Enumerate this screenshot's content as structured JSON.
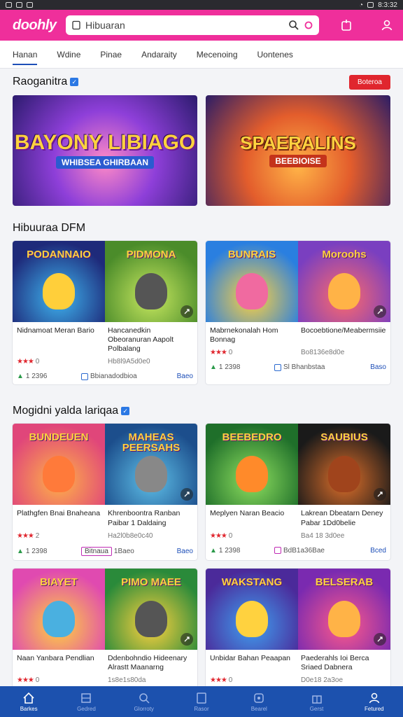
{
  "status_bar": {
    "time": "8:3:32"
  },
  "app_bar": {
    "logo": "doohly",
    "search_value": "Hibuaran"
  },
  "tabs": [
    "Hanan",
    "Wdine",
    "Pinae",
    "Andaraity",
    "Mecenoing",
    "Uontenes"
  ],
  "section1": {
    "title": "Raoganitra",
    "badge_label": "Boteroa"
  },
  "banners": [
    {
      "title": "BAYONY LIBIAGO",
      "subtitle": "WHIBSEA GHIRBAAN"
    },
    {
      "title": "SPAERALINS",
      "subtitle": "BEEBIOISE"
    }
  ],
  "section2": {
    "title": "Hibuuraa DFM"
  },
  "section3": {
    "title": "Mogidni yalda lariqaa"
  },
  "cards": [
    {
      "arts": [
        "PODANNAIO",
        "PIDMONA"
      ],
      "names": [
        "Nidnamoat Meran Bario",
        "Hancanedkin Obeoranuran Aapolt Polbalang"
      ],
      "rating": "0",
      "stars": "★★★",
      "meta": "Hb8l9A5d0e0",
      "count": "1 2396",
      "tag": "Bbianadodbioa",
      "mid_icon": "chk",
      "link": "Baeo"
    },
    {
      "arts": [
        "BUNRAIS",
        "Moroohs"
      ],
      "names": [
        "Mabrnekonalah Hom Bonnag",
        "Bocoebtione/Meabermsiie"
      ],
      "rating": "0",
      "stars": "★★★",
      "meta": "Bo8136e8d0e",
      "count": "1 2398",
      "tag": "Sl Bhanbstaa",
      "mid_icon": "chk",
      "link": "Baso"
    },
    {
      "arts": [
        "BUNDEUEN",
        "MAHEAS PEERSAHS"
      ],
      "names": [
        "Plathgfen Bnai Bnaheana",
        "Khrenboontra Ranban Paibar 1 Daldaing"
      ],
      "rating": "2",
      "stars": "★★★",
      "meta": "Ha2l0b8e0c40",
      "count": "1 2398",
      "tag": "Bitnaua",
      "mid_extra": "1Baeo",
      "mid_icon": "hl",
      "link": "Baeo"
    },
    {
      "arts": [
        "BEEBEDRO",
        "SAUBIUS"
      ],
      "names": [
        "Meplyen Naran Beacio",
        "Lakrean Dbeatarn Deney Pabar 1Dd0belie"
      ],
      "rating": "0",
      "stars": "★★★",
      "meta": "Ba4 18 3d0ee",
      "count": "1 2398",
      "tag": "BdB1a36Bae",
      "mid_icon": "chkpink",
      "link": "Bced"
    },
    {
      "arts": [
        "BIAYET",
        "PIMO MAEE"
      ],
      "names": [
        "Naan Yanbara Pendlian",
        "Ddenbohndio Hideenary Alrastt Maanarng"
      ],
      "rating": "0",
      "stars": "★★★",
      "meta": "1s8e1s80da"
    },
    {
      "arts": [
        "WAKSTANG",
        "BELSERAB"
      ],
      "names": [
        "Unbidar Bahan Peaapan",
        "Paederahls Ioi Berca Sriaed Dabnera"
      ],
      "rating": "0",
      "stars": "★★★",
      "meta": "D0e18 2a3oe"
    }
  ],
  "bottom_nav": [
    "Barkes",
    "Gedred",
    "Glorroty",
    "Rasor",
    "Bearel",
    "Gerst",
    "Fetured"
  ]
}
